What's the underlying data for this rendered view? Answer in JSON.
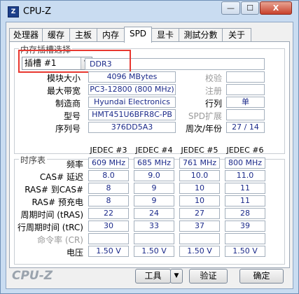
{
  "window": {
    "title": "CPU-Z",
    "icon_text": "Z",
    "controls": {
      "minimize": "—",
      "maximize": "☐",
      "close": "X"
    }
  },
  "tabs": [
    {
      "label": "处理器"
    },
    {
      "label": "缓存"
    },
    {
      "label": "主板"
    },
    {
      "label": "内存"
    },
    {
      "label": "SPD",
      "active": true
    },
    {
      "label": "显卡"
    },
    {
      "label": "測試分數"
    },
    {
      "label": "关于"
    }
  ],
  "slot_section": {
    "title": "内存插槽选择",
    "slot_select": "插槽 #1",
    "memory_type": "DDR3",
    "module_size_label": "模块大小",
    "module_size": "4096 MBytes",
    "max_bandwidth_label": "最大带宽",
    "max_bandwidth": "PC3-12800 (800 MHz)",
    "manufacturer_label": "制造商",
    "manufacturer": "Hyundai Electronics",
    "part_number_label": "型号",
    "part_number": "HMT451U6BFR8C-PB",
    "serial_label": "序列号",
    "serial": "376DD5A3",
    "check_label": "校验",
    "check": "",
    "registered_label": "注册",
    "registered": "",
    "ranks_label": "行列",
    "ranks": "单",
    "spd_ext_label": "SPD扩展",
    "spd_ext": "",
    "week_year_label": "周次/年份",
    "week_year": "27 / 14"
  },
  "timings": {
    "title": "时序表",
    "columns": [
      "JEDEC #3",
      "JEDEC #4",
      "JEDEC #5",
      "JEDEC #6"
    ],
    "rows": [
      {
        "label": "频率",
        "values": [
          "609 MHz",
          "685 MHz",
          "761 MHz",
          "800 MHz"
        ],
        "dim": false
      },
      {
        "label": "CAS# 延迟",
        "values": [
          "8.0",
          "9.0",
          "10.0",
          "11.0"
        ],
        "dim": false
      },
      {
        "label": "RAS# 到CAS#",
        "values": [
          "8",
          "9",
          "10",
          "11"
        ],
        "dim": false
      },
      {
        "label": "RAS# 预充电",
        "values": [
          "8",
          "9",
          "10",
          "11"
        ],
        "dim": false
      },
      {
        "label": "周期时间 (tRAS)",
        "values": [
          "22",
          "24",
          "27",
          "28"
        ],
        "dim": false
      },
      {
        "label": "行周期时间 (tRC)",
        "values": [
          "30",
          "33",
          "37",
          "39"
        ],
        "dim": false
      },
      {
        "label": "命令率 (CR)",
        "values": [
          "",
          "",
          "",
          ""
        ],
        "dim": true
      },
      {
        "label": "电压",
        "values": [
          "1.50 V",
          "1.50 V",
          "1.50 V",
          "1.50 V"
        ],
        "dim": false
      }
    ]
  },
  "footer": {
    "logo": "CPU-Z",
    "tools_button": "工具",
    "tools_arrow": "▼",
    "validate_button": "验证",
    "ok_button": "确定"
  }
}
